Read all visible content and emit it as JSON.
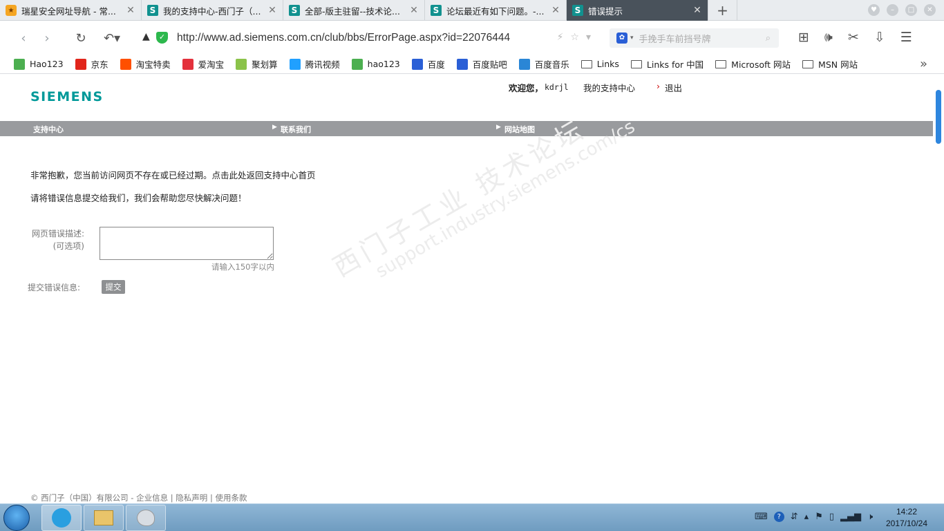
{
  "tabs": [
    {
      "title": "瑞星安全网址导航 - 常...",
      "icon": "tiger-icon"
    },
    {
      "title": "我的支持中心-西门子（...",
      "icon": "s-icon"
    },
    {
      "title": "全部-版主驻留--技术论...",
      "icon": "s-icon"
    },
    {
      "title": "论坛最近有如下问题。-...",
      "icon": "s-icon"
    },
    {
      "title": "错误提示",
      "icon": "s-icon",
      "active": true
    }
  ],
  "address": {
    "url": "http://www.ad.siemens.com.cn/club/bbs/ErrorPage.aspx?id=22076444"
  },
  "search": {
    "placeholder": "手挽手车前挡号牌"
  },
  "bookmarks": [
    {
      "label": "Hao123",
      "color": "#4caf50"
    },
    {
      "label": "京东",
      "color": "#e1251b"
    },
    {
      "label": "淘宝特卖",
      "color": "#ff5000"
    },
    {
      "label": "爱淘宝",
      "color": "#e3313c"
    },
    {
      "label": "聚划算",
      "color": "#8bc34a"
    },
    {
      "label": "腾讯视频",
      "color": "#20a0ff"
    },
    {
      "label": "hao123",
      "color": "#4caf50"
    },
    {
      "label": "百度",
      "color": "#2a5fd6"
    },
    {
      "label": "百度贴吧",
      "color": "#2a5fd6"
    },
    {
      "label": "百度音乐",
      "color": "#2a86d6"
    },
    {
      "label": "Links",
      "folder": true
    },
    {
      "label": "Links for 中国",
      "folder": true
    },
    {
      "label": "Microsoft 网站",
      "folder": true
    },
    {
      "label": "MSN 网站",
      "folder": true
    }
  ],
  "page": {
    "logo": "SIEMENS",
    "welcome": "欢迎您，",
    "username": "kdrjl",
    "my_support": "我的支持中心",
    "logout": "退出",
    "nav": [
      "支持中心",
      "联系我们",
      "网站地图"
    ],
    "message1": "非常抱歉，您当前访问网页不存在或已经过期。点击此处返回支持中心首页",
    "message2": "请将错误信息提交给我们，我们会帮助您尽快解决问题！",
    "desc_label_line1": "网页错误描述:",
    "desc_label_line2": "(可选项)",
    "hint": "请输入150字以内",
    "submit_label": "提交错误信息:",
    "submit_button": "提交",
    "watermark_line1": "西门子工业 技术论坛",
    "watermark_line2": "support.industry.siemens.com/cs",
    "footer": "© 西门子（中国）有限公司 - 企业信息 | 隐私声明 | 使用条款"
  },
  "taskbar": {
    "time": "14:22",
    "date": "2017/10/24"
  }
}
